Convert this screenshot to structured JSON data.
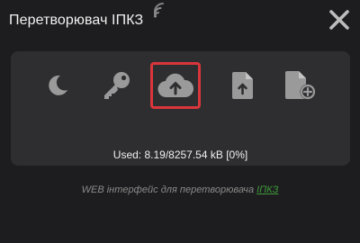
{
  "header": {
    "title": "Перетворювач ІПКЗ",
    "status_icon": "wifi-signal-icon",
    "close_icon": "close-icon"
  },
  "toolbar": {
    "tools": [
      {
        "icon": "moon-icon",
        "selected": false
      },
      {
        "icon": "key-icon",
        "selected": false
      },
      {
        "icon": "cloud-upload-icon",
        "selected": true
      },
      {
        "icon": "file-upload-icon",
        "selected": false
      },
      {
        "icon": "file-add-icon",
        "selected": false
      }
    ],
    "storage_used": "Used: 8.19/8257.54 kB [0%]"
  },
  "footer": {
    "text": "WEB інтерфейс для перетворювача",
    "link": "ІПКЗ"
  },
  "colors": {
    "background": "#1d1d1f",
    "panel": "#2e2e30",
    "icon": "#9a9a9a",
    "selected_border": "#d9363b",
    "link": "#3f9a3a"
  }
}
